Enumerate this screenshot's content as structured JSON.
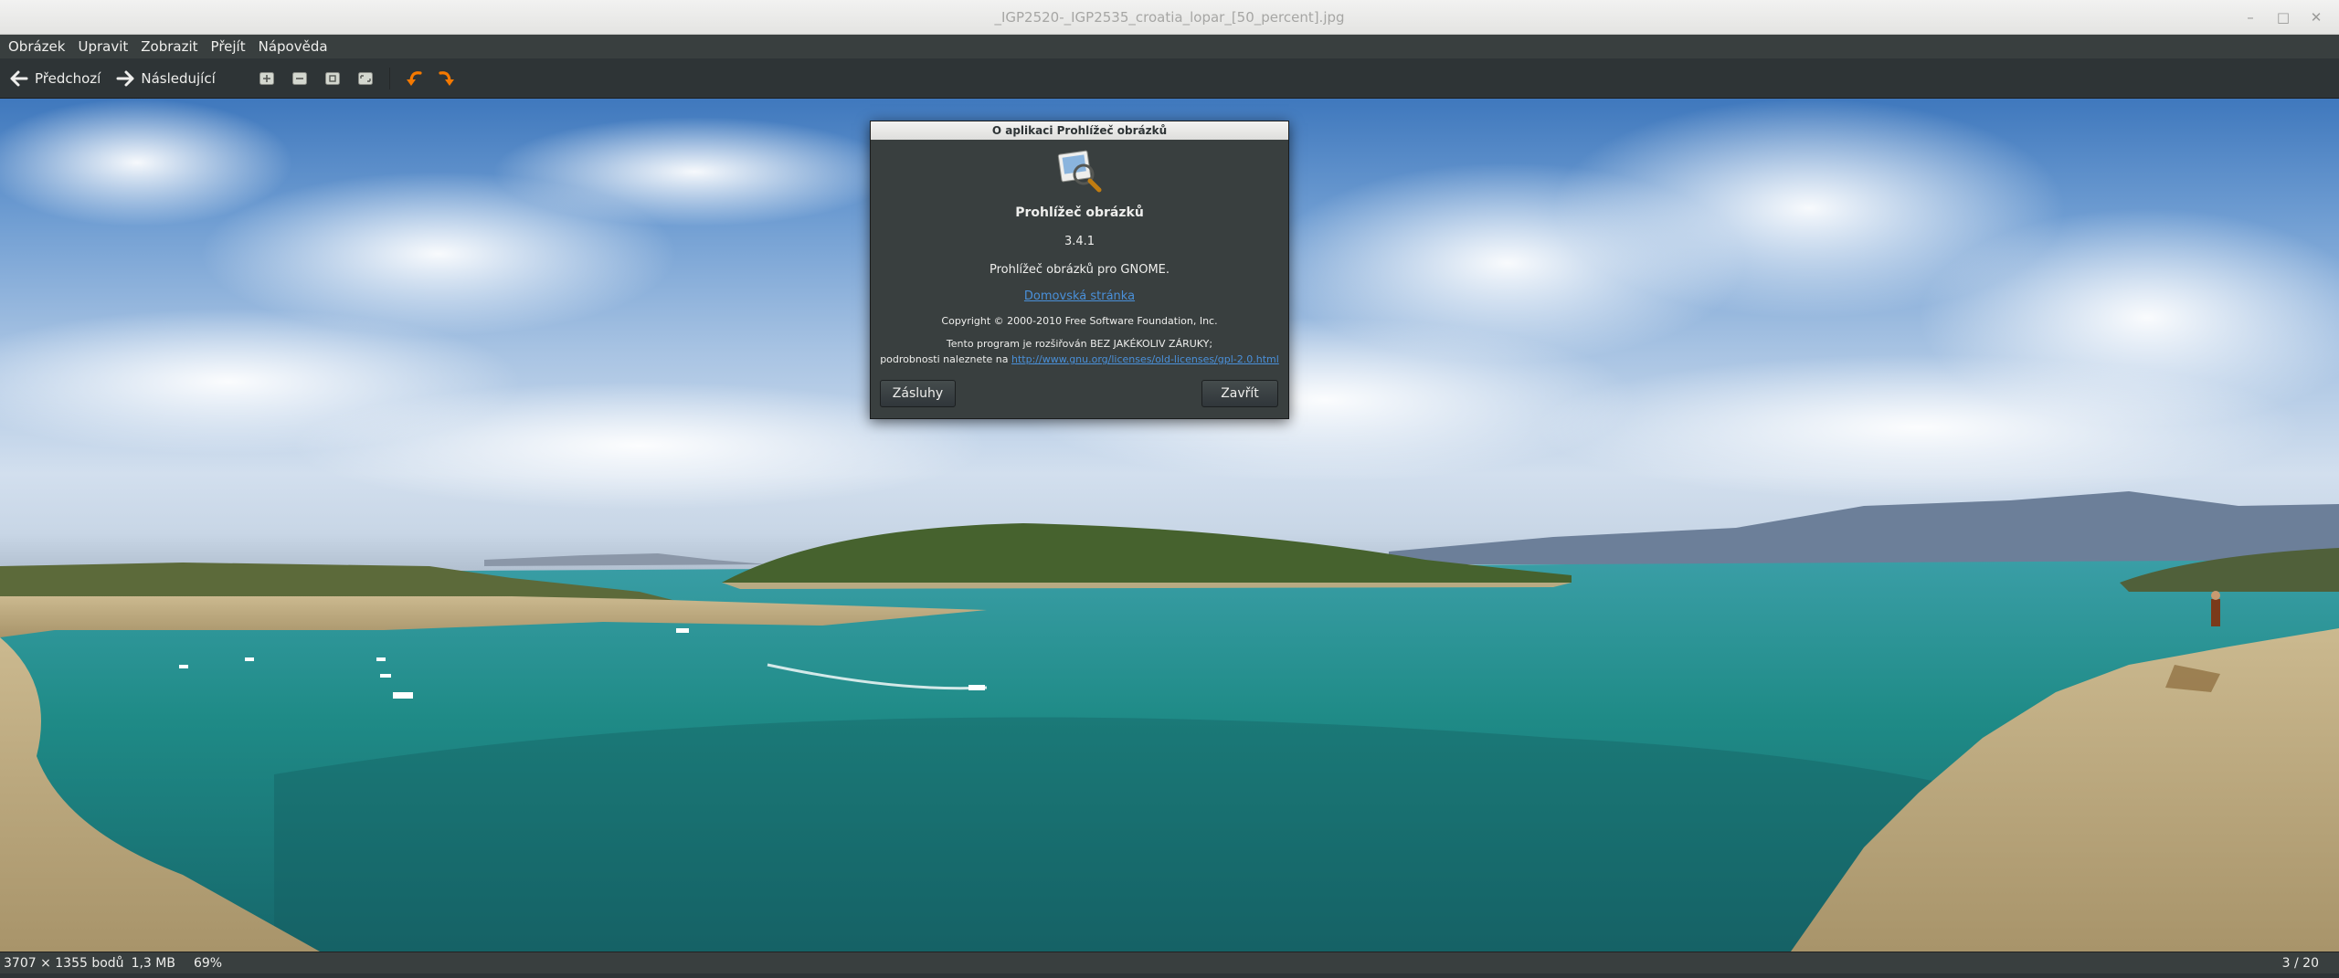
{
  "window": {
    "title": "_IGP2520-_IGP2535_croatia_lopar_[50_percent].jpg",
    "controls": [
      "–",
      "□",
      "✕"
    ]
  },
  "menu": [
    "Obrázek",
    "Upravit",
    "Zobrazit",
    "Přejít",
    "Nápověda"
  ],
  "toolbar": {
    "prev_label": "Předchozí",
    "next_label": "Následující",
    "icons": [
      "zoom-in-icon",
      "zoom-normal-icon",
      "zoom-out-icon",
      "zoom-fit-icon",
      "rotate-left-icon",
      "rotate-right-icon"
    ]
  },
  "about_dialog": {
    "title": "O aplikaci Prohlížeč obrázků",
    "app_name": "Prohlížeč obrázků",
    "version": "3.4.1",
    "description": "Prohlížeč obrázků pro GNOME.",
    "website_label": "Domovská stránka",
    "copyright": "Copyright © 2000-2010 Free Software Foundation, Inc.",
    "license_line1": "Tento program je rozšiřován BEZ JAKÉKOLIV ZÁRUKY;",
    "license_line2_prefix": "podrobnosti naleznete na ",
    "license_url": "http://www.gnu.org/licenses/old-licenses/gpl-2.0.html",
    "credits_button": "Zásluhy",
    "close_button": "Zavřít"
  },
  "status": {
    "dimensions": "3707 × 1355 bodů",
    "size": "1,3 MB",
    "zoom": "69%",
    "position": "3 / 20"
  },
  "colors": {
    "toolbar_bg": "#2e3436",
    "menubar_bg": "#393f3f",
    "link": "#4a90d9",
    "sea": "#1f8a88"
  }
}
